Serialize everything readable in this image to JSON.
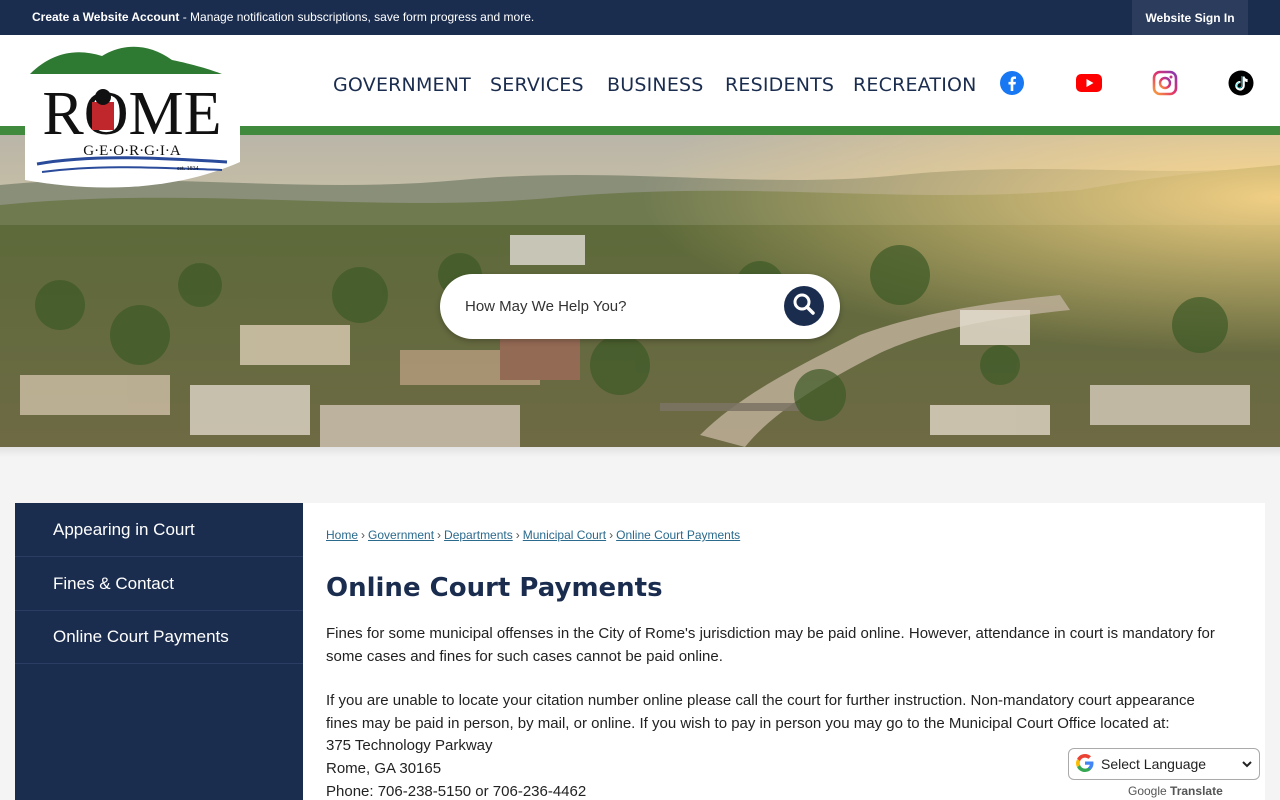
{
  "topbar": {
    "account_bold": "Create a Website Account",
    "account_rest": " - Manage notification subscriptions, save form progress and more.",
    "signin": "Website Sign In"
  },
  "logo": {
    "city": "ROME",
    "state": "G·E·O·R·G·I·A",
    "est": "est. 1834"
  },
  "nav": {
    "items": [
      "GOVERNMENT",
      "SERVICES",
      "BUSINESS",
      "RESIDENTS",
      "RECREATION"
    ],
    "social": [
      "facebook-icon",
      "youtube-icon",
      "instagram-icon",
      "tiktok-icon"
    ]
  },
  "search": {
    "placeholder": "How May We Help You?"
  },
  "sidebar": {
    "items": [
      {
        "label": "Appearing in Court"
      },
      {
        "label": "Fines & Contact"
      },
      {
        "label": "Online Court Payments"
      }
    ]
  },
  "breadcrumb": [
    "Home",
    "Government",
    "Departments",
    "Municipal Court",
    "Online Court Payments"
  ],
  "page": {
    "title": "Online Court Payments",
    "p1": "Fines for some municipal offenses in the City of Rome's jurisdiction may be paid online. However, attendance in court is mandatory for some cases and fines for such cases cannot be paid online.",
    "p2": "If you are unable to locate your citation number online please call the court for further instruction. Non-mandatory court appearance fines may be paid in person, by mail, or online. If you wish to pay in person you may go to the Municipal Court Office located at:",
    "address1": "375 Technology Parkway",
    "address2": "Rome, GA 30165",
    "phone": "Phone: 706-238-5150 or 706-236-4462"
  },
  "translate": {
    "select": "Select Language",
    "powered_by": "Google",
    "translate": "Translate"
  },
  "colors": {
    "navy": "#1b2d4f",
    "green": "#3f8a3c",
    "link": "#2a6a8d"
  }
}
